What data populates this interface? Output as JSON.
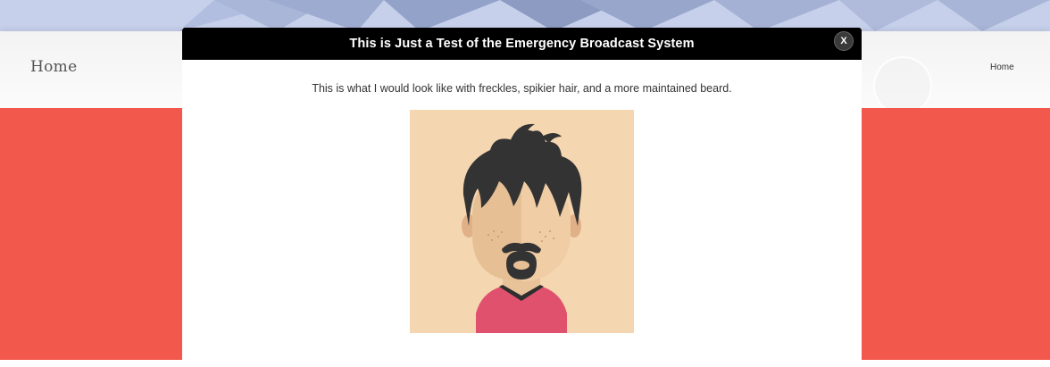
{
  "header": {
    "site_title": "Home",
    "nav": [
      {
        "label": "Home"
      }
    ]
  },
  "modal": {
    "title": "This is Just a Test of the Emergency Broadcast System",
    "close_label": "X",
    "body_text": "This is what I would look like with freckles, spikier hair, and a more maintained beard.",
    "image_icon": "cartoon-avatar"
  },
  "colors": {
    "accent_red": "#f2584b",
    "modal_header": "#000000",
    "avatar_background": "#f4d6b0",
    "shirt": "#e0516e",
    "hair": "#333333"
  }
}
